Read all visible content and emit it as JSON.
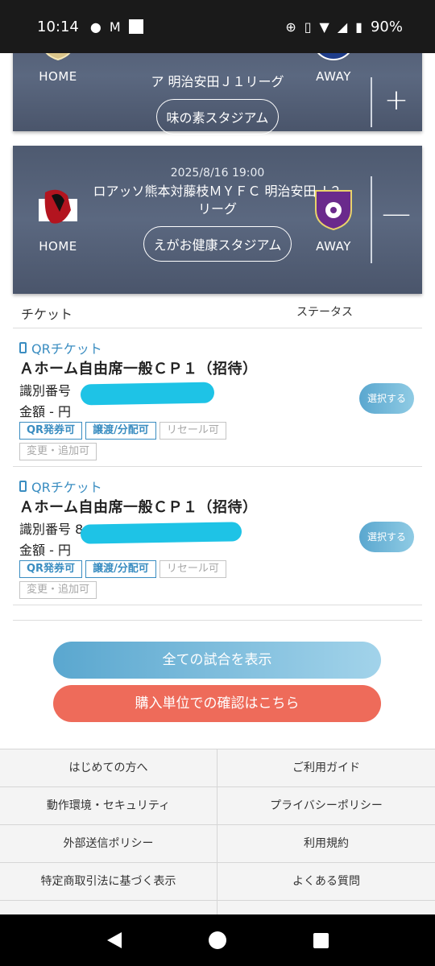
{
  "status_bar": {
    "time": "10:14",
    "icons_left": [
      "line-icon",
      "gmail-icon",
      "square-icon"
    ],
    "battery": "90%"
  },
  "matches": [
    {
      "date": "",
      "name": "ア 明治安田Ｊ１リーグ",
      "stadium": "味の素スタジアム",
      "home_label": "HOME",
      "away_label": "AWAY",
      "toggle": "+"
    },
    {
      "date": "2025/8/16 19:00",
      "name": "ロアッソ熊本対藤枝ＭＹＦＣ 明治安田Ｊ２リーグ",
      "stadium": "えがお健康スタジアム",
      "home_label": "HOME",
      "away_label": "AWAY",
      "toggle": "—"
    }
  ],
  "ticket_table": {
    "col_ticket": "チケット",
    "col_status": "ステータス"
  },
  "tickets": [
    {
      "type": "QRチケット",
      "seat": "Ａホーム自由席一般ＣＰ１（招待）",
      "id_label": "識別番号",
      "id_value": "",
      "price": "金額 - 円",
      "tags": [
        "QR発券可",
        "譲渡/分配可",
        "リセール可",
        "変更・追加可"
      ],
      "select_label": "選択する"
    },
    {
      "type": "QRチケット",
      "seat": "Ａホーム自由席一般ＣＰ１（招待）",
      "id_label": "識別番号",
      "id_value": "8",
      "price": "金額 - 円",
      "tags": [
        "QR発券可",
        "譲渡/分配可",
        "リセール可",
        "変更・追加可"
      ],
      "select_label": "選択する"
    }
  ],
  "buttons": {
    "show_all": "全ての試合を表示",
    "by_purchase": "購入単位での確認はこちら"
  },
  "footer_links": [
    "はじめての方へ",
    "ご利用ガイド",
    "動作環境・セキュリティ",
    "プライバシーポリシー",
    "外部送信ポリシー",
    "利用規約",
    "特定商取引法に基づく表示",
    "よくある質問"
  ],
  "colors": {
    "accent_blue": "#3a8dc1",
    "card_bg": "#56627a",
    "purchase_red": "#ee6b5a",
    "redaction": "#1ec3e6"
  }
}
